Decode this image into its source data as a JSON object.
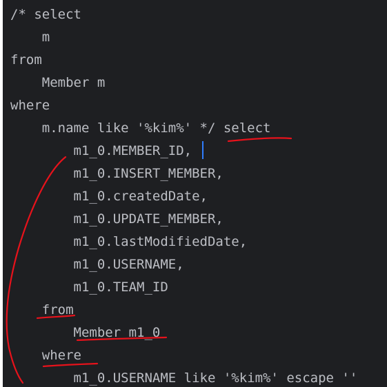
{
  "editor": {
    "lines": [
      {
        "text": "/* select"
      },
      {
        "text": "    m"
      },
      {
        "text": "from"
      },
      {
        "text": "    Member m"
      },
      {
        "text": "where"
      },
      {
        "text": "    m.name like '%kim%' */ select"
      },
      {
        "text": "        m1_0.MEMBER_ID,"
      },
      {
        "text": "        m1_0.INSERT_MEMBER,"
      },
      {
        "text": "        m1_0.createdDate,"
      },
      {
        "text": "        m1_0.UPDATE_MEMBER,"
      },
      {
        "text": "        m1_0.lastModifiedDate,"
      },
      {
        "text": "        m1_0.USERNAME,"
      },
      {
        "text": "        m1_0.TEAM_ID"
      },
      {
        "text": "    from"
      },
      {
        "text": "        Member m1_0"
      },
      {
        "text": "    where"
      },
      {
        "text": "        m1_0.USERNAME like '%kim%' escape ''"
      }
    ]
  },
  "annotation": {
    "color": "#e8121b"
  }
}
